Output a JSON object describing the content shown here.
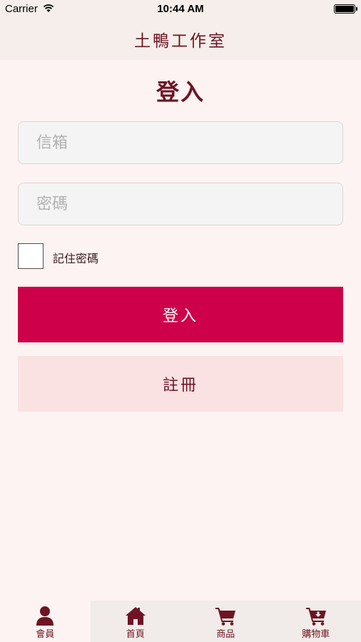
{
  "status_bar": {
    "carrier": "Carrier",
    "time": "10:44 AM"
  },
  "header": {
    "title": "土鴨工作室"
  },
  "page_title": "登入",
  "form": {
    "email_placeholder": "信箱",
    "email_value": "",
    "password_placeholder": "密碼",
    "password_value": "",
    "remember_label": "記住密碼",
    "remember_checked": false,
    "login_label": "登入",
    "register_label": "註冊"
  },
  "tabs": [
    {
      "label": "會員",
      "icon": "user-icon",
      "active": true
    },
    {
      "label": "首頁",
      "icon": "home-icon",
      "active": false
    },
    {
      "label": "商品",
      "icon": "cart-icon",
      "active": false
    },
    {
      "label": "購物車",
      "icon": "cart-download-icon",
      "active": false
    }
  ],
  "colors": {
    "accent": "#ce004a",
    "text_primary": "#6e1424",
    "background": "#fdf3f2",
    "register_bg": "#fae2e2"
  }
}
